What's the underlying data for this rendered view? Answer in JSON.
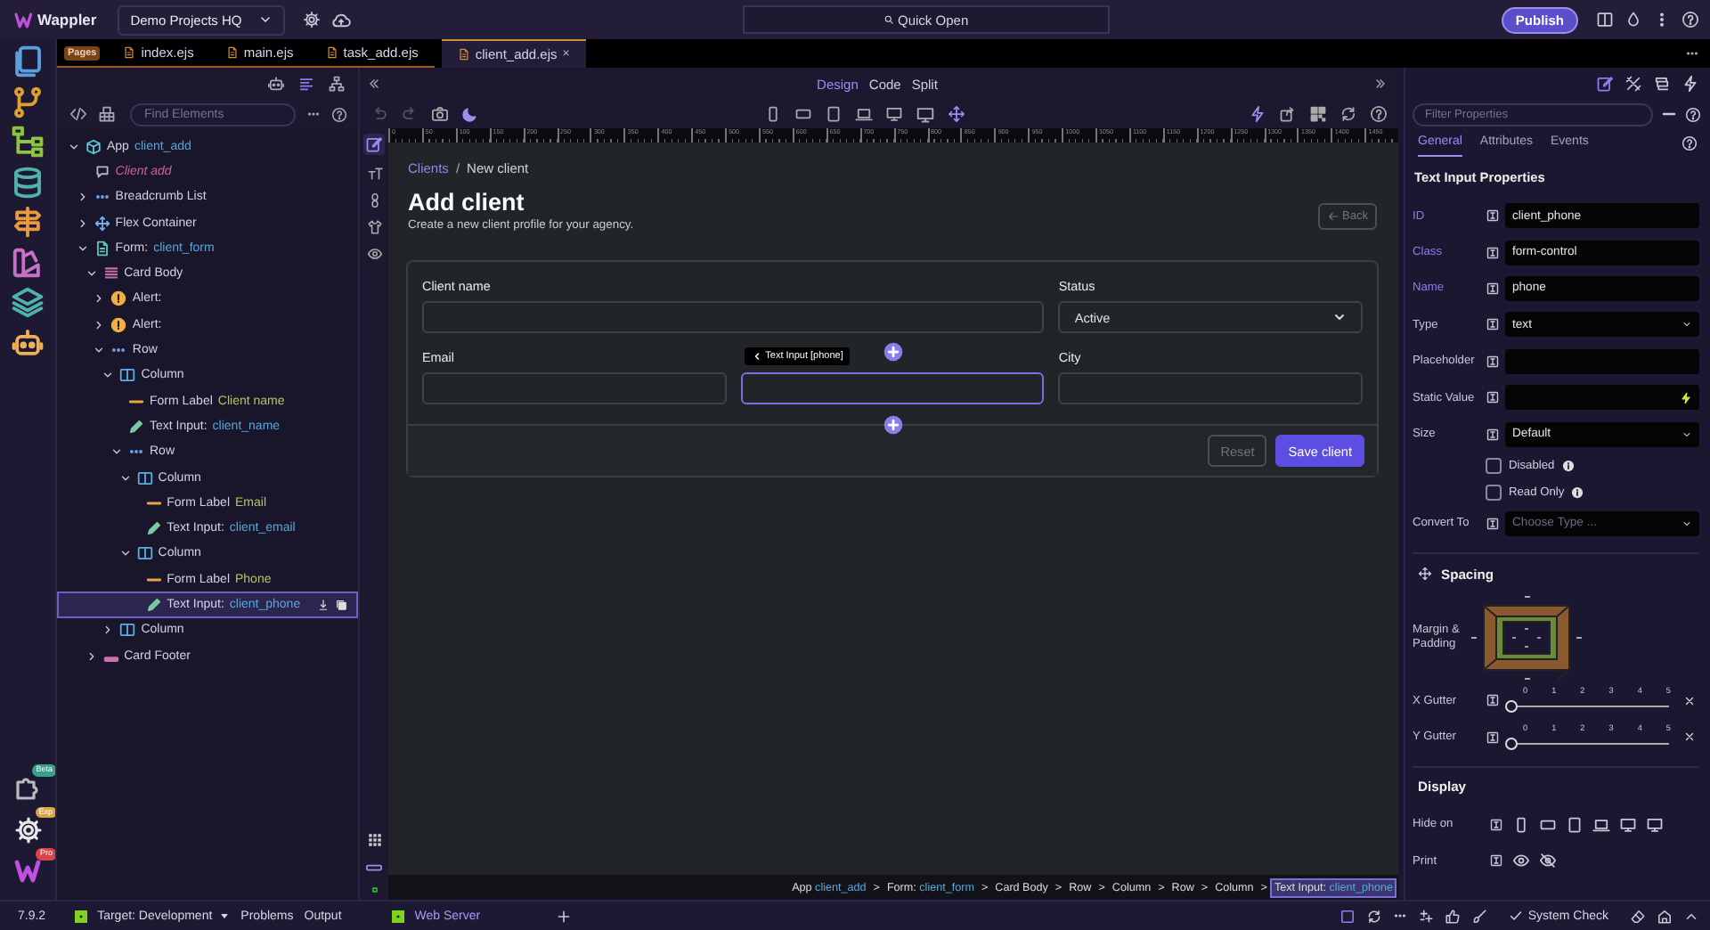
{
  "topbar": {
    "app_name": "Wappler",
    "project": "Demo Projects HQ",
    "quick_open": {
      "placeholder": "Quick Open"
    },
    "publish": "Publish"
  },
  "activity_bar": {
    "badges": [
      {
        "label": "Beta",
        "color": "#3aa08a"
      },
      {
        "label": "Exp",
        "color": "#d9a441"
      },
      {
        "label": "Pro",
        "color": "#d9434a"
      }
    ]
  },
  "file_tabs": {
    "section": "Pages",
    "tabs": [
      {
        "label": "index.ejs",
        "selected": false
      },
      {
        "label": "main.ejs",
        "selected": false
      },
      {
        "label": "task_add.ejs",
        "selected": false
      },
      {
        "label": "client_add.ejs",
        "selected": true,
        "close": "×"
      }
    ]
  },
  "outline": {
    "search": {
      "placeholder": "Find Elements"
    },
    "tree": [
      {
        "kind": "app",
        "label": "App",
        "name": "client_add",
        "expanded": true,
        "selected": false,
        "children": [
          {
            "kind": "action",
            "label": "Client add",
            "selected": false
          },
          {
            "kind": "breadcrumb",
            "label": "Breadcrumb List",
            "expanded": false,
            "selected": false
          },
          {
            "kind": "flex",
            "label": "Flex Container",
            "expanded": false,
            "selected": false
          },
          {
            "kind": "form",
            "label": "Form:",
            "name": "client_form",
            "expanded": true,
            "selected": false,
            "children": [
              {
                "kind": "card-body",
                "label": "Card Body",
                "expanded": true,
                "selected": false,
                "children": [
                  {
                    "kind": "alert",
                    "label": "Alert:",
                    "expanded": false,
                    "selected": false
                  },
                  {
                    "kind": "alert",
                    "label": "Alert:",
                    "expanded": false,
                    "selected": false
                  },
                  {
                    "kind": "row",
                    "label": "Row",
                    "expanded": true,
                    "selected": false,
                    "children": [
                      {
                        "kind": "column",
                        "label": "Column",
                        "expanded": true,
                        "selected": false,
                        "children": [
                          {
                            "kind": "label",
                            "label": "Form Label",
                            "name": "Client name",
                            "selected": false
                          },
                          {
                            "kind": "input",
                            "label": "Text Input:",
                            "name": "client_name",
                            "selected": false
                          },
                          {
                            "kind": "row",
                            "label": "Row",
                            "expanded": true,
                            "selected": false,
                            "children": [
                              {
                                "kind": "column",
                                "label": "Column",
                                "expanded": true,
                                "selected": false,
                                "children": [
                                  {
                                    "kind": "label",
                                    "label": "Form Label",
                                    "name": "Email",
                                    "selected": false
                                  },
                                  {
                                    "kind": "input",
                                    "label": "Text Input:",
                                    "name": "client_email",
                                    "selected": false
                                  }
                                ]
                              },
                              {
                                "kind": "column",
                                "label": "Column",
                                "expanded": true,
                                "selected": false,
                                "children": [
                                  {
                                    "kind": "label",
                                    "label": "Form Label",
                                    "name": "Phone",
                                    "selected": false
                                  },
                                  {
                                    "kind": "input",
                                    "label": "Text Input:",
                                    "name": "client_phone",
                                    "selected": true
                                  }
                                ]
                              }
                            ]
                          }
                        ]
                      },
                      {
                        "kind": "column",
                        "label": "Column",
                        "expanded": false,
                        "selected": false
                      }
                    ]
                  }
                ]
              },
              {
                "kind": "card-footer",
                "label": "Card Footer",
                "expanded": false,
                "selected": false
              }
            ]
          }
        ]
      }
    ]
  },
  "design": {
    "view_modes": [
      {
        "label": "Design",
        "selected": true
      },
      {
        "label": "Code",
        "selected": false
      },
      {
        "label": "Split",
        "selected": false
      }
    ],
    "ruler_marks": [
      "0",
      "50",
      "100",
      "150",
      "200",
      "250",
      "300",
      "350",
      "400",
      "450",
      "500",
      "550",
      "600",
      "650",
      "700",
      "750",
      "800",
      "850",
      "900",
      "950",
      "1000",
      "1050",
      "1100",
      "1150",
      "1200",
      "1250",
      "1300",
      "1350",
      "1400",
      "1450"
    ],
    "page": {
      "breadcrumb": {
        "separator": "/",
        "items": [
          {
            "kind": "link",
            "label": "Clients"
          },
          {
            "kind": "current",
            "label": "New client"
          }
        ]
      },
      "title": "Add client",
      "subtitle": "Create a new client profile for your agency.",
      "back_button": "Back",
      "rows": [
        [
          {
            "kind": "input",
            "label": "Client name",
            "selected": false
          },
          {
            "kind": "select",
            "label": "Status",
            "value": "Active",
            "selected": false
          }
        ],
        [
          {
            "kind": "input",
            "label": "Email",
            "selected": false
          },
          {
            "kind": "input",
            "selected": true
          },
          {
            "kind": "input",
            "label": "City",
            "selected": false
          }
        ]
      ],
      "buttons": [
        {
          "kind": "secondary",
          "label": "Reset"
        },
        {
          "kind": "primary",
          "label": "Save client"
        }
      ]
    },
    "tooltip": "Text Input [phone]",
    "path": {
      "separator": ">",
      "items": [
        {
          "label": "App",
          "name": "client_add",
          "selected": false
        },
        {
          "label": "Form:",
          "name": "client_form",
          "selected": false
        },
        {
          "label": "Card Body",
          "selected": false
        },
        {
          "label": "Row",
          "selected": false
        },
        {
          "label": "Column",
          "selected": false
        },
        {
          "label": "Row",
          "selected": false
        },
        {
          "label": "Column",
          "selected": false
        },
        {
          "label": "Text Input:",
          "name": "client_phone",
          "selected": true
        }
      ]
    }
  },
  "properties": {
    "filter": {
      "placeholder": "Filter Properties"
    },
    "tabs": [
      {
        "label": "General",
        "selected": true
      },
      {
        "label": "Attributes",
        "selected": false
      },
      {
        "label": "Events",
        "selected": false
      }
    ],
    "title": "Text Input Properties",
    "rows": [
      {
        "kind": "text",
        "label": "ID",
        "value": "client_phone",
        "highlighted": true
      },
      {
        "kind": "text",
        "label": "Class",
        "value": "form-control",
        "highlighted": true
      },
      {
        "kind": "text",
        "label": "Name",
        "value": "phone",
        "highlighted": true
      },
      {
        "kind": "select",
        "label": "Type",
        "value": "text",
        "highlighted": false
      },
      {
        "kind": "text",
        "label": "Placeholder",
        "highlighted": false
      },
      {
        "kind": "dynamic",
        "label": "Static Value",
        "highlighted": false
      },
      {
        "kind": "select",
        "label": "Size",
        "value": "Default",
        "highlighted": false
      },
      {
        "kind": "checkbox",
        "label": "Disabled",
        "checked": false
      },
      {
        "kind": "checkbox",
        "label": "Read Only",
        "checked": false
      },
      {
        "kind": "select",
        "label": "Convert To",
        "placeholder": "Choose Type ...",
        "highlighted": false
      }
    ],
    "spacing": {
      "title": "Spacing",
      "label": "Margin & Padding"
    },
    "gutters": [
      {
        "label": "X Gutter",
        "ticks": [
          "0",
          "1",
          "2",
          "3",
          "4",
          "5"
        ],
        "level": 0
      },
      {
        "label": "Y Gutter",
        "ticks": [
          "0",
          "1",
          "2",
          "3",
          "4",
          "5"
        ],
        "level": 0
      }
    ],
    "display": {
      "title": "Display",
      "rows": [
        {
          "kind": "devices",
          "label": "Hide on"
        },
        {
          "kind": "print",
          "label": "Print"
        }
      ]
    }
  },
  "status_bar": {
    "version": "7.9.2",
    "target": "Target: Development",
    "problems": "Problems",
    "output": "Output",
    "server": "Web Server",
    "system_check": "System Check"
  }
}
